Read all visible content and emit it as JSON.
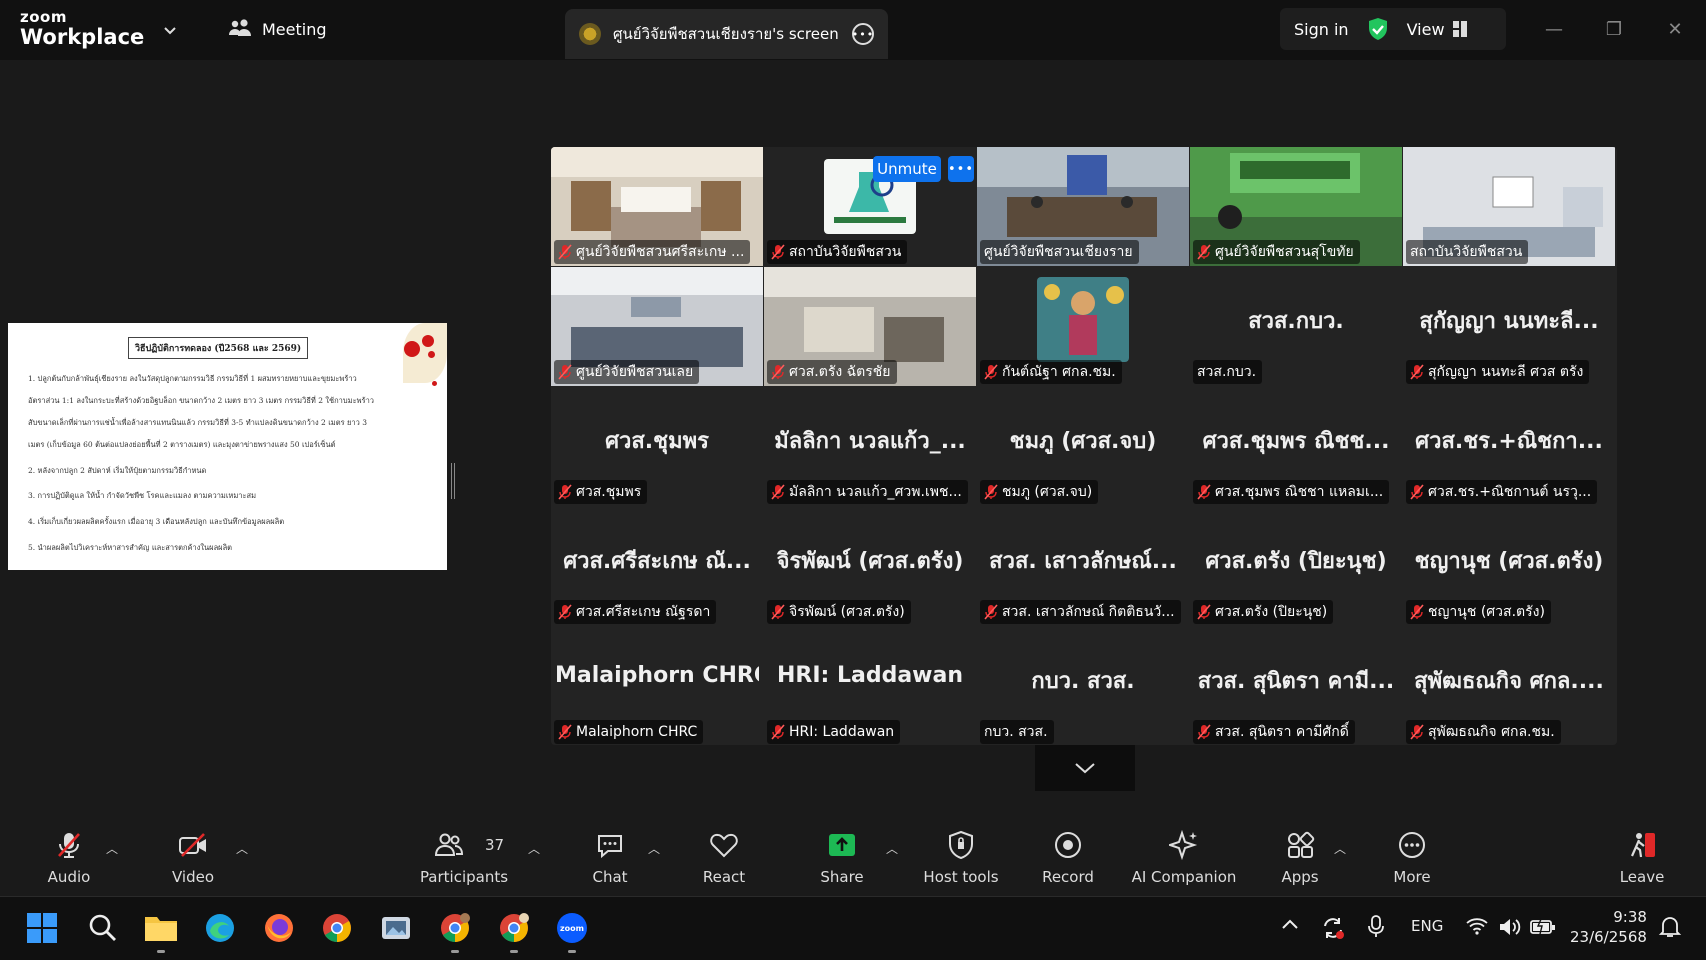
{
  "titlebar": {
    "brand_top": "zoom",
    "brand_bottom": "Workplace",
    "meeting_label": "Meeting",
    "share_tab_label": "ศูนย์วิจัยพืชสวนเชียงราย's screen",
    "sign_in": "Sign in",
    "view": "View"
  },
  "slide": {
    "title": "วิธีปฏิบัติการทดลอง  (ปี2568 และ 2569)",
    "lines": [
      "1.   ปลูกต้นกับกล้าพันธุ์เชียงราย ลงในวัสดุปลูกตามกรรมวิธี กรรมวิธีที่ 1 ผสมทรายหยาบและขุยมะพร้าว",
      "      อัตราส่วน 1:1 ลงในกระบะที่สร้างด้วยอิฐบล็อก ขนาดกว้าง 2 เมตร ยาว 3 เมตร กรรมวิธีที่ 2 ใช้กาบมะพร้าว",
      "      สับขนาดเล็กที่ผ่านการแช่น้ำเพื่อล้างสารแทนนินแล้ว กรรมวิธีที่ 3-5 ทำแปลงดินขนาดกว้าง 2 เมตร ยาว 3",
      "      เมตร (เก็บข้อมูล 60 ต้นต่อแปลงย่อยพื้นที่ 2 ตารางเมตร) และมุงตาข่ายพรางแสง 50 เปอร์เซ็นต์",
      "2.   หลังจากปลูก 2 สัปดาห์ เริ่มให้ปุ๋ยตามกรรมวิธีกำหนด",
      "3.   การปฏิบัติดูแล ให้น้ำ กำจัดวัชพืช โรคและแมลง ตามความเหมาะสม",
      "4.   เริ่มเก็บเกี่ยวผลผลิตครั้งแรก เมื่ออายุ 3 เดือนหลังปลูก และบันทึกข้อมูลผลผลิต",
      "5.   นำผลผลิตไปวิเคราะห์หาสารสำคัญ และสารตกค้างในผลผลิต"
    ]
  },
  "gallery": {
    "unmute_label": "Unmute",
    "tiles": [
      {
        "big": "",
        "label": "ศูนย์วิจัยพืชสวนศรีสะเกษ ...",
        "muted": true,
        "video": "room-a"
      },
      {
        "big": "",
        "label": "สถาบันวิจัยพืชสวน",
        "muted": true,
        "video": "logo"
      },
      {
        "big": "",
        "label": "ศูนย์วิจัยพืชสวนเชียงราย",
        "muted": false,
        "video": "room-b",
        "active": true
      },
      {
        "big": "",
        "label": "ศูนย์วิจัยพืชสวนสุโขทัย",
        "muted": true,
        "video": "room-green"
      },
      {
        "big": "",
        "label": "สถาบันวิจัยพืชสวน",
        "muted": false,
        "video": "room-c"
      },
      {
        "big": "",
        "label": "ศูนย์วิจัยพืชสวนเลย",
        "muted": true,
        "video": "room-d"
      },
      {
        "big": "",
        "label": "ศวส.ตรัง ฉัตรชัย",
        "muted": true,
        "video": "room-e"
      },
      {
        "big": "",
        "label": "กันต์ณัฐา ศกล.ชม.",
        "muted": true,
        "video": "avatar"
      },
      {
        "big": "สวส.กบว.",
        "label": "สวส.กบว.",
        "muted": false
      },
      {
        "big": "สุกัญญา นนทะลี...",
        "label": "สุกัญญา นนทะลี ศวส ตรัง",
        "muted": true
      },
      {
        "big": "ศวส.ชุมพร",
        "label": "ศวส.ชุมพร",
        "muted": true
      },
      {
        "big": "มัลลิกา นวลแก้ว_...",
        "label": "มัลลิกา นวลแก้ว_ศวพ.เพช...",
        "muted": true
      },
      {
        "big": "ชมภู (ศวส.จบ)",
        "label": "ชมภู (ศวส.จบ)",
        "muted": true
      },
      {
        "big": "ศวส.ชุมพร ณิชช...",
        "label": "ศวส.ชุมพร ณิชชา แหลมเ...",
        "muted": true
      },
      {
        "big": "ศวส.ชร.+ณิชกา...",
        "label": "ศวส.ชร.+ณิชกานต์ นรวุ...",
        "muted": true
      },
      {
        "big": "ศวส.ศรีสะเกษ ณั...",
        "label": "ศวส.ศรีสะเกษ ณัฐรดา",
        "muted": true
      },
      {
        "big": "จิรพัฒน์ (ศวส.ตรัง)",
        "label": "จิรพัฒน์ (ศวส.ตรัง)",
        "muted": true
      },
      {
        "big": "สวส. เสาวลักษณ์...",
        "label": "สวส. เสาวลักษณ์ กิตติธนวั...",
        "muted": true
      },
      {
        "big": "ศวส.ตรัง (ปิยะนุช)",
        "label": "ศวส.ตรัง (ปิยะนุช)",
        "muted": true
      },
      {
        "big": "ชญานุช (ศวส.ตรัง)",
        "label": "ชญานุช (ศวส.ตรัง)",
        "muted": true
      },
      {
        "big": "Malaiphorn CHRC",
        "label": "Malaiphorn CHRC",
        "muted": true
      },
      {
        "big": "HRI: Laddawan",
        "label": "HRI: Laddawan",
        "muted": true
      },
      {
        "big": "กบว. สวส.",
        "label": "กบว. สวส.",
        "muted": false
      },
      {
        "big": "สวส. สุนิตรา คามี...",
        "label": "สวส. สุนิตรา คามีศักดิ์",
        "muted": true
      },
      {
        "big": "สุพัฒธณกิจ ศกล....",
        "label": "สุพัฒธณกิจ ศกล.ชม.",
        "muted": true
      }
    ]
  },
  "toolbar": {
    "audio": "Audio",
    "video": "Video",
    "participants": "Participants",
    "participants_count": "37",
    "chat": "Chat",
    "react": "React",
    "share": "Share",
    "host_tools": "Host tools",
    "record": "Record",
    "ai_companion": "AI Companion",
    "apps": "Apps",
    "more": "More",
    "leave": "Leave"
  },
  "taskbar": {
    "language": "ENG",
    "time": "9:38",
    "date": "23/6/2568"
  },
  "colors": {
    "accent_blue": "#0e72ed",
    "active_green": "#2ad061",
    "share_green": "#1db954",
    "mute_red": "#e02828"
  }
}
